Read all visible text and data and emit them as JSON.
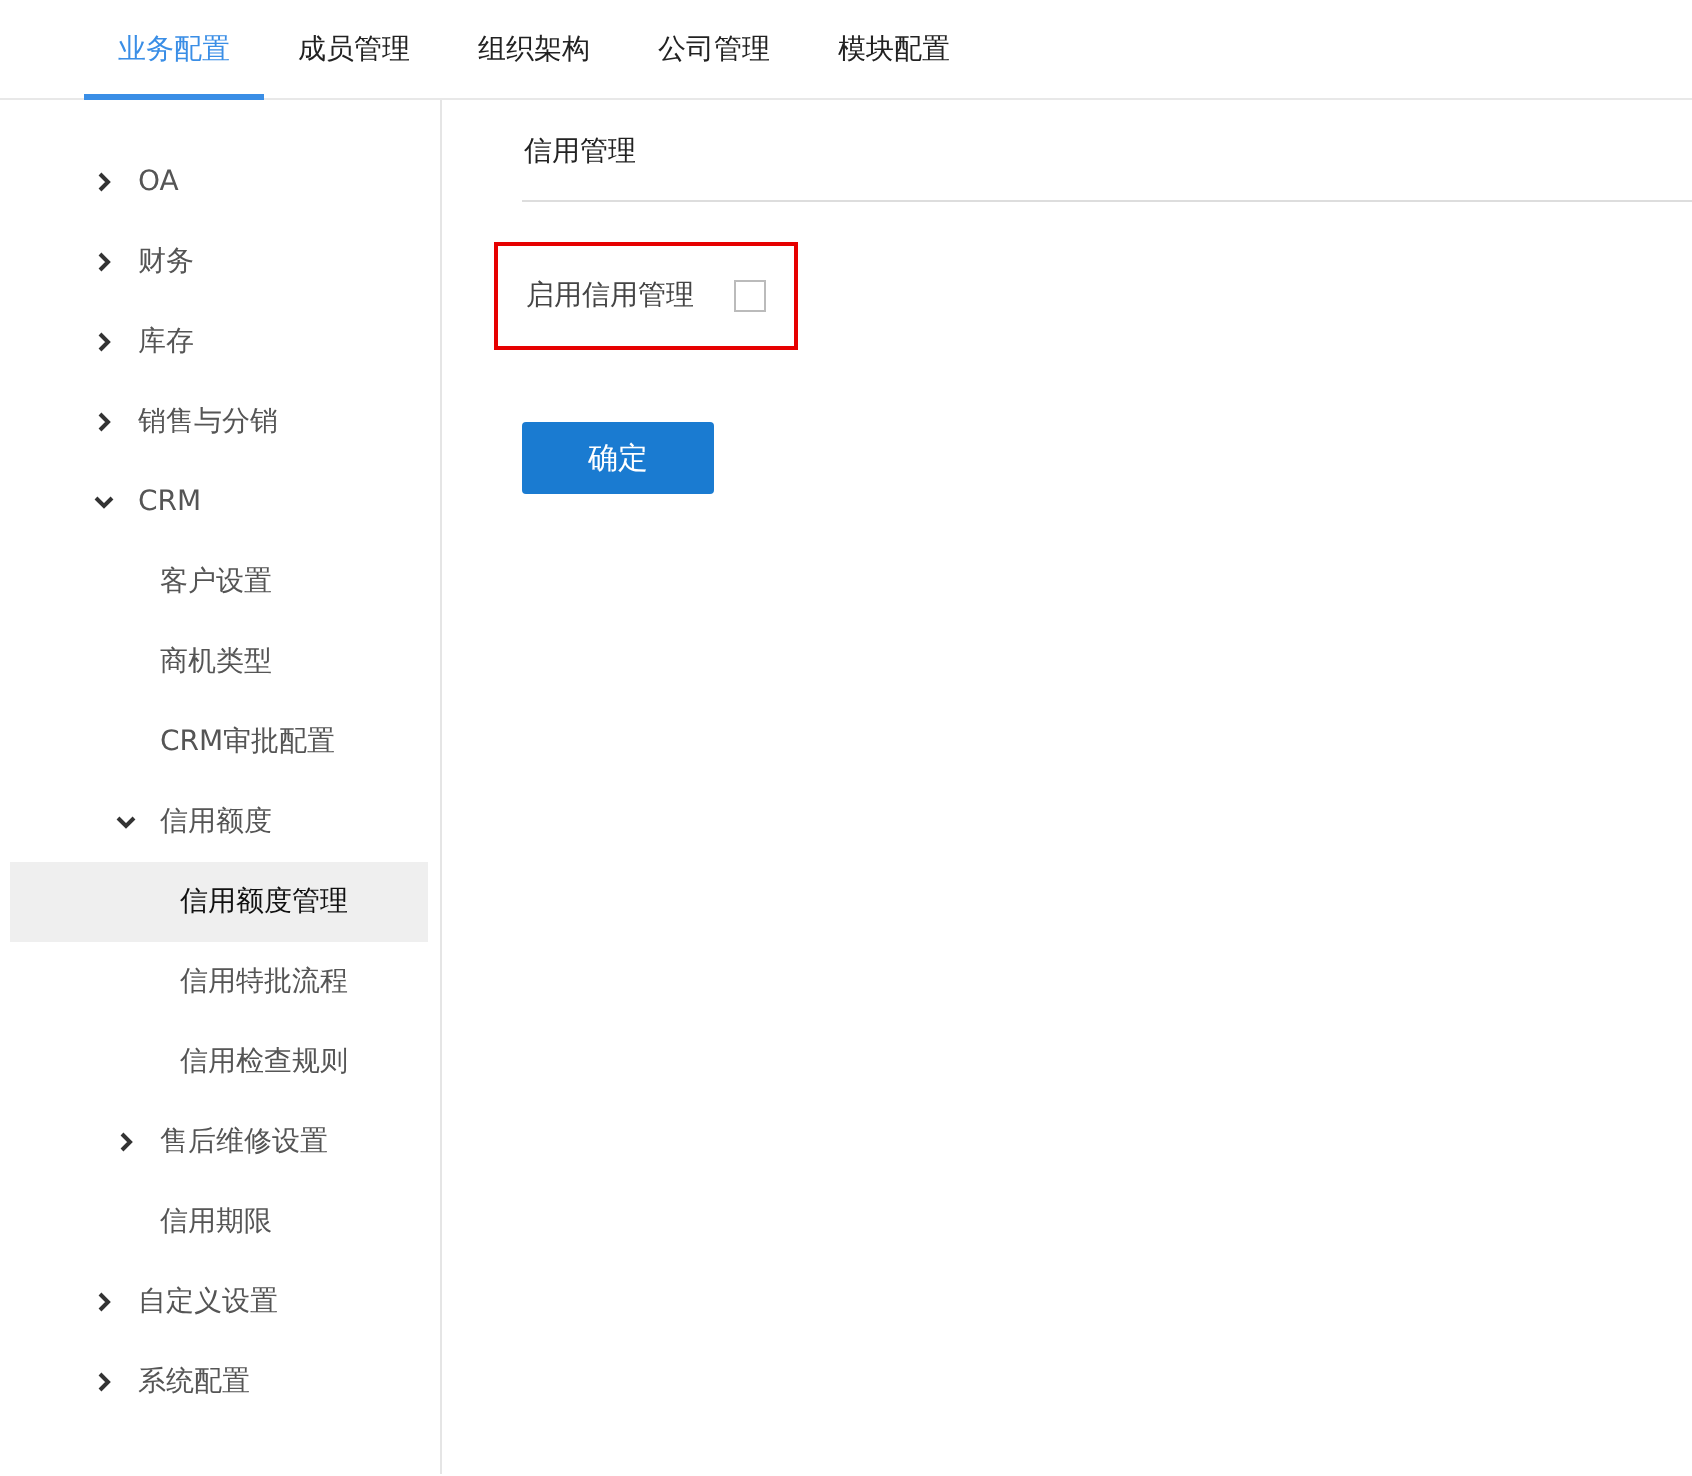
{
  "tabs": [
    {
      "label": "业务配置",
      "selected": true
    },
    {
      "label": "成员管理",
      "selected": false
    },
    {
      "label": "组织架构",
      "selected": false
    },
    {
      "label": "公司管理",
      "selected": false
    },
    {
      "label": "模块配置",
      "selected": false
    }
  ],
  "sidebar": {
    "items": [
      {
        "label": "OA",
        "expanded": false,
        "selected": false
      },
      {
        "label": "财务",
        "expanded": false,
        "selected": false
      },
      {
        "label": "库存",
        "expanded": false,
        "selected": false
      },
      {
        "label": "销售与分销",
        "expanded": false,
        "selected": false
      },
      {
        "label": "CRM",
        "expanded": true,
        "selected": false,
        "children": [
          {
            "label": "客户设置",
            "selected": false
          },
          {
            "label": "商机类型",
            "selected": false
          },
          {
            "label": "CRM审批配置",
            "selected": false
          },
          {
            "label": "信用额度",
            "expanded": true,
            "selected": false,
            "children": [
              {
                "label": "信用额度管理",
                "selected": true
              },
              {
                "label": "信用特批流程",
                "selected": false
              },
              {
                "label": "信用检查规则",
                "selected": false
              }
            ]
          },
          {
            "label": "售后维修设置",
            "expanded": false,
            "selected": false
          },
          {
            "label": "信用期限",
            "selected": false
          }
        ]
      },
      {
        "label": "自定义设置",
        "expanded": false,
        "selected": false
      },
      {
        "label": "系统配置",
        "expanded": false,
        "selected": false
      }
    ]
  },
  "panel": {
    "title": "信用管理",
    "setting": {
      "label": "启用信用管理",
      "checked": false,
      "highlighted": true
    },
    "confirm_button": "确定"
  }
}
